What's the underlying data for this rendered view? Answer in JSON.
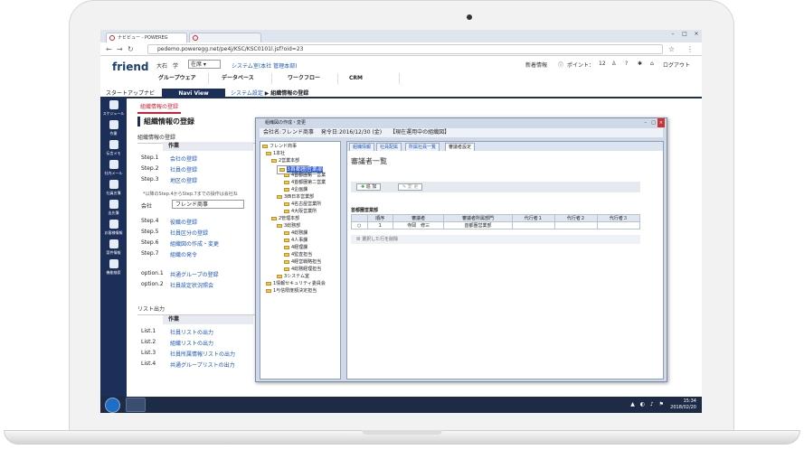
{
  "browser": {
    "tab1": "ナビビュー - POWEREG",
    "url": "pedemo.poweregg.net/pe4j/KSC/KSC0101l.jsf?oid=23"
  },
  "app": {
    "logo": "friend",
    "user_name": "大石　学",
    "status_select": "在席",
    "dept_link": "システム室(本社 管理本部)",
    "menus": [
      "グループウェア",
      "データベース",
      "ワークフロー",
      "CRM"
    ],
    "new_info": "新着情報",
    "points_label": "ポイント：",
    "points_value": "12",
    "logout": "ログアウト"
  },
  "navbar": {
    "start": "スタートアップナビ",
    "navi_view": "Navi View",
    "crumb_link": "システム設定",
    "crumb_current": "組織情報の登録"
  },
  "sidebar": [
    "スケジュール",
    "作業",
    "伝言メモ",
    "社内メール",
    "社員名簿",
    "出先簿",
    "お客様情報",
    "案件情報",
    "機能検索"
  ],
  "content": {
    "tab": "組織情報の登録",
    "title": "組織情報の登録",
    "section1": "組織情報の登録",
    "col_task": "作業",
    "steps_a": [
      {
        "step": "Step.1",
        "link": "会社の登録"
      },
      {
        "step": "Step.2",
        "link": "社員の登録"
      },
      {
        "step": "Step.3",
        "link": "地区の登録"
      }
    ],
    "note": "*以降のStep.4からStep.7までの操作は会社ね",
    "company_label": "会社",
    "company_value": "フレンド商事",
    "steps_b": [
      {
        "step": "Step.4",
        "link": "役職の登録"
      },
      {
        "step": "Step.5",
        "link": "社員区分の登録"
      },
      {
        "step": "Step.6",
        "link": "組織図の作成・変更"
      },
      {
        "step": "Step.7",
        "link": "組織の発令"
      }
    ],
    "options": [
      {
        "step": "option.1",
        "link": "共通グループの登録"
      },
      {
        "step": "option.2",
        "link": "社員設定状況照会"
      }
    ],
    "section2": "リスト出力",
    "lists": [
      {
        "step": "List.1",
        "link": "社員リストの出力"
      },
      {
        "step": "List.2",
        "link": "組織リストの出力"
      },
      {
        "step": "List.3",
        "link": "社員所属情報リストの出力"
      },
      {
        "step": "List.4",
        "link": "共通グループリストの出力"
      }
    ]
  },
  "dialog": {
    "title": "組織図の作成・変更",
    "info": "会社名:フレンド商事　 発令日:2016/12/30 (金)　　【現在運用中の組織図】",
    "tree": [
      {
        "label": "フレンド商事",
        "level": 0
      },
      {
        "label": "1本社",
        "level": 1
      },
      {
        "label": "2営業本部",
        "level": 2
      },
      {
        "label": "3首都圏営業部",
        "level": 3,
        "selected": true
      },
      {
        "label": "4首都圏第一営業",
        "level": 4
      },
      {
        "label": "4首都圏第二営業",
        "level": 4
      },
      {
        "label": "4企画課",
        "level": 4
      },
      {
        "label": "3西日本営業部",
        "level": 3
      },
      {
        "label": "4名古屋営業所",
        "level": 4
      },
      {
        "label": "4大阪営業所",
        "level": 4
      },
      {
        "label": "2管理本部",
        "level": 2
      },
      {
        "label": "3総務部",
        "level": 3
      },
      {
        "label": "4総務課",
        "level": 4
      },
      {
        "label": "4人事課",
        "level": 4
      },
      {
        "label": "4経理課",
        "level": 4
      },
      {
        "label": "4監査担当",
        "level": 4
      },
      {
        "label": "4経営戦略担当",
        "level": 4
      },
      {
        "label": "4総務経理担当",
        "level": 4
      },
      {
        "label": "3システム室",
        "level": 3
      },
      {
        "label": "1情報セキュリティ委員会",
        "level": 1
      },
      {
        "label": "1与信限度額決定担当",
        "level": 1
      }
    ],
    "tabs": [
      "組織情報",
      "社員配属",
      "所属社員一覧",
      "審議者設定"
    ],
    "heading": "審議者一覧",
    "add_btn": "追 加",
    "change_btn": "変 更",
    "group": "首都圏営業部",
    "columns": [
      "",
      "順序",
      "審議者",
      "審議者所属部門",
      "代行者１",
      "代行者２",
      "代行者３"
    ],
    "rows": [
      [
        "○",
        "1",
        "寺岡　修三",
        "首都圏営業部",
        "",
        "",
        ""
      ]
    ],
    "delete_row": "選択した行を削除"
  },
  "taskbar": {
    "time": "15:34",
    "date": "2018/02/20"
  }
}
